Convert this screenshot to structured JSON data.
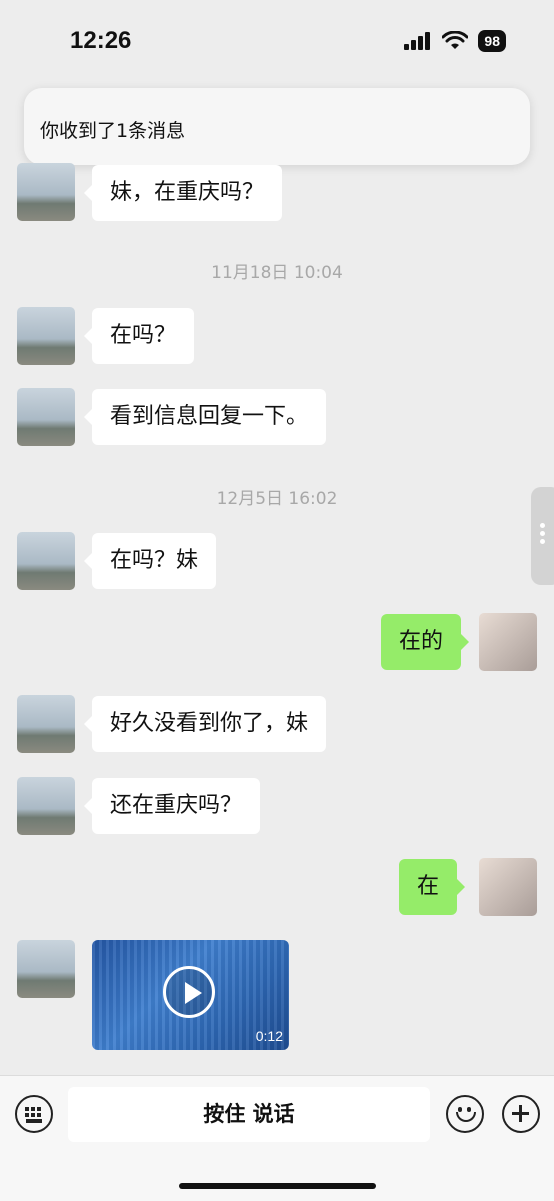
{
  "status": {
    "time": "12:26",
    "battery": "98"
  },
  "notification": {
    "text": "你收到了1条消息"
  },
  "messages": {
    "m1": "妹，在重庆吗？",
    "ts1": "11月18日 10:04",
    "m2": "在吗？",
    "m3": "看到信息回复一下。",
    "ts2": "12月5日 16:02",
    "m4": "在吗？妹",
    "m5": "在的",
    "m6": "好久没看到你了，妹",
    "m7": "还在重庆吗？",
    "m8": "在",
    "video_duration": "0:12"
  },
  "input_bar": {
    "hold_to_talk": "按住 说话"
  },
  "icons": {
    "signal": "signal-icon",
    "wifi": "wifi-icon",
    "battery": "battery-icon",
    "keyboard": "keyboard-icon",
    "emoji": "emoji-icon",
    "plus": "plus-icon",
    "play": "play-icon"
  },
  "colors": {
    "outgoing_bubble": "#95ec69",
    "incoming_bubble": "#ffffff",
    "background": "#ededed"
  }
}
